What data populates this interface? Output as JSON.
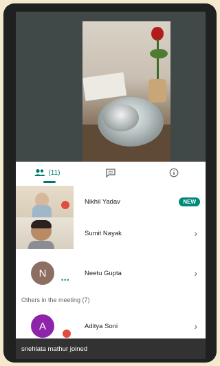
{
  "tabs": [
    {
      "icon": "people-icon",
      "label": "(11)"
    },
    {
      "icon": "chat-icon",
      "label": ""
    },
    {
      "icon": "info-icon",
      "label": ""
    }
  ],
  "participants": [
    {
      "name": "Nikhil Yadav",
      "badge": "NEW"
    },
    {
      "name": "Sumit Nayak"
    },
    {
      "name": "Neetu Gupta",
      "initial": "N",
      "avatar_color": "#8d6e63"
    },
    {
      "name": "Aditya Soni",
      "initial": "A",
      "avatar_color": "#8e24aa"
    }
  ],
  "section_label": "Others in the meeting (7)",
  "toast": "snehlata mathur joined",
  "colors": {
    "accent": "#00796b",
    "mic_off": "#e34b3f"
  }
}
